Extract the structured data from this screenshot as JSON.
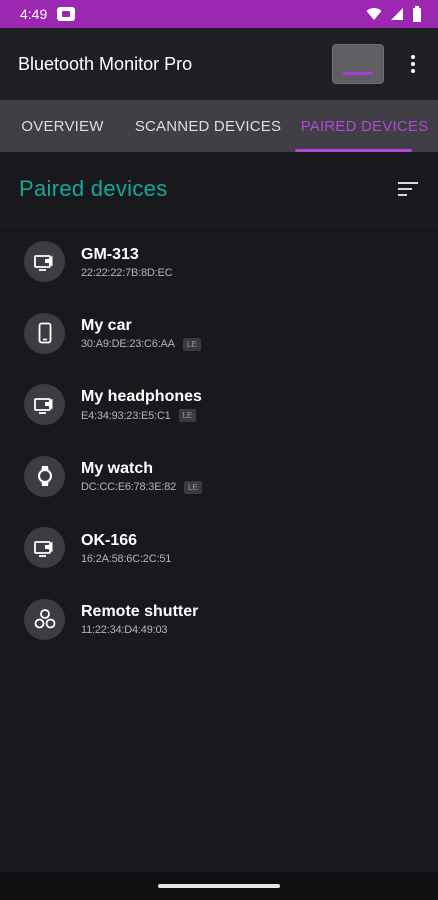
{
  "status_bar": {
    "time": "4:49",
    "icons": [
      "notification-icon",
      "wifi-icon",
      "signal-icon",
      "battery-icon"
    ]
  },
  "app_bar": {
    "title": "Bluetooth Monitor Pro",
    "more_icon": "more-vertical-icon"
  },
  "tabs": [
    {
      "label": "OVERVIEW",
      "active": false
    },
    {
      "label": "SCANNED DEVICES",
      "active": false
    },
    {
      "label": "PAIRED DEVICES",
      "active": true
    }
  ],
  "section": {
    "title": "Paired devices",
    "sort_icon": "sort-icon"
  },
  "devices": [
    {
      "name": "GM-313",
      "mac": "22:22:22:7B:8D:EC",
      "badge": "",
      "icon": "audio-video-icon"
    },
    {
      "name": "My car",
      "mac": "30:A9:DE:23:C6:AA",
      "badge": "LE",
      "icon": "phone-icon"
    },
    {
      "name": "My headphones",
      "mac": "E4:34:93:23:E5:C1",
      "badge": "LE",
      "icon": "audio-video-icon"
    },
    {
      "name": "My watch",
      "mac": "DC:CC:E6:78:3E:82",
      "badge": "LE",
      "icon": "watch-icon"
    },
    {
      "name": "OK-166",
      "mac": "16:2A:58:6C:2C:51",
      "badge": "",
      "icon": "audio-video-icon"
    },
    {
      "name": "Remote shutter",
      "mac": "11:22:34:D4:49:03",
      "badge": "",
      "icon": "device-hub-icon"
    }
  ],
  "colors": {
    "status_bar": "#9c27b0",
    "accent": "#b447d6",
    "section_title": "#14a99a",
    "background": "#19191d"
  }
}
